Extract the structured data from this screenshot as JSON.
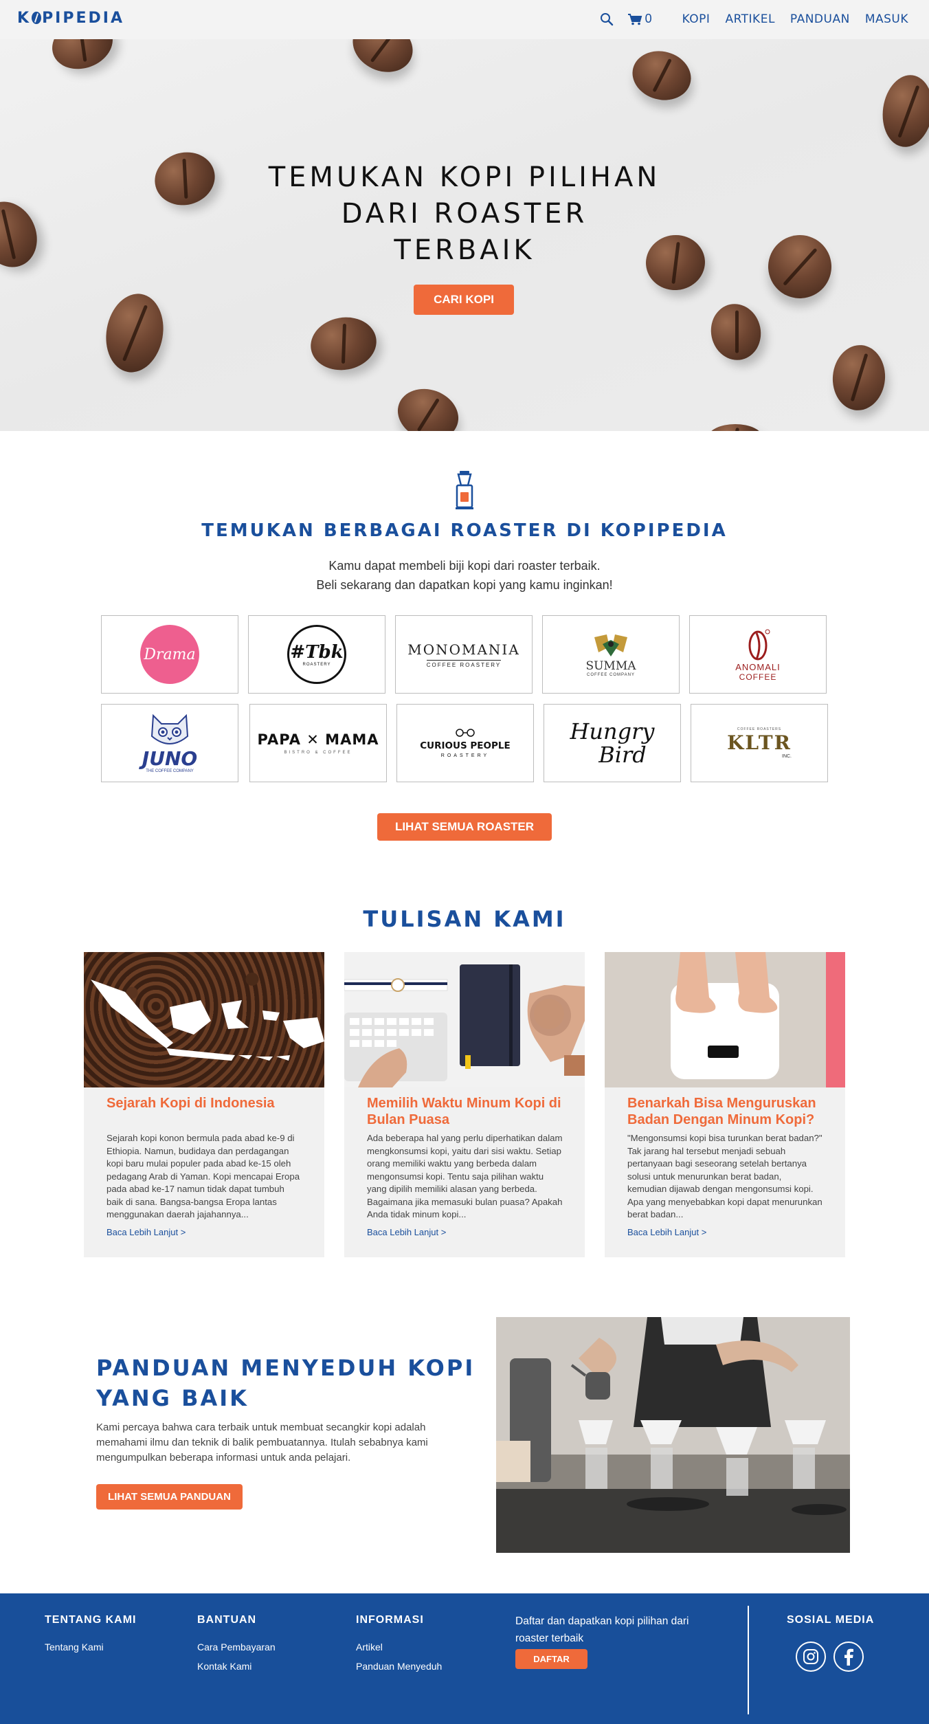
{
  "nav": {
    "logo": "KOPIPEDIA",
    "cart_count": "0",
    "links": [
      "KOPI",
      "ARTIKEL",
      "PANDUAN",
      "MASUK"
    ]
  },
  "hero": {
    "title_lines": [
      "TEMUKAN KOPI PILIHAN",
      "DARI ROASTER",
      "TERBAIK"
    ],
    "button": "CARI KOPI"
  },
  "roasters": {
    "title": "TEMUKAN BERBAGAI ROASTER DI KOPIPEDIA",
    "subtitle_lines": [
      "Kamu dapat membeli biji kopi dari roaster terbaik.",
      "Beli sekarang dan dapatkan kopi yang kamu inginkan!"
    ],
    "logos": {
      "drama": "Drama",
      "tbk": "#Tbk",
      "tbk_sub": "ROASTERY",
      "monomania": "MONOMANIA",
      "monomania_sub": "COFFEE ROASTERY",
      "summa": "SUMMA",
      "summa_sub": "COFFEE COMPANY",
      "anomali": "ANOMALI",
      "anomali_sub": "COFFEE",
      "juno": "JUNO",
      "juno_sub": "THE COFFEE COMPANY",
      "papamama": "PAPA ✕ MAMA",
      "papamama_sub": "BISTRO & COFFEE",
      "curious": "CURIOUS PEOPLE",
      "curious_sub": "ROASTERY",
      "hungry": "Hungry",
      "bird": "Bird",
      "kltr": "KLTR",
      "kltr_top": "COFFEE   ROASTERS",
      "kltr_sub": "INC."
    },
    "button": "LIHAT SEMUA ROASTER"
  },
  "articles": {
    "title": "TULISAN KAMI",
    "items": [
      {
        "title": "Sejarah Kopi di Indonesia",
        "body": "Sejarah kopi konon bermula pada abad ke-9 di Ethiopia. Namun, budidaya dan perdagangan kopi baru mulai populer pada abad ke-15 oleh pedagang Arab di Yaman. Kopi mencapai Eropa pada abad ke-17 namun tidak dapat tumbuh baik di sana. Bangsa-bangsa Eropa lantas menggunakan daerah jajahannya...",
        "link": "Baca Lebih Lanjut >"
      },
      {
        "title": "Memilih Waktu Minum Kopi di Bulan Puasa",
        "body": "Ada beberapa hal yang perlu diperhatikan dalam mengkonsumsi kopi, yaitu dari sisi waktu. Setiap orang memiliki waktu yang berbeda dalam mengonsumsi kopi. Tentu saja pilihan waktu yang dipilih memiliki alasan yang berbeda. Bagaimana jika memasuki bulan puasa?  Apakah Anda tidak minum kopi...",
        "link": "Baca Lebih Lanjut >"
      },
      {
        "title": "Benarkah Bisa Menguruskan Badan Dengan Minum Kopi?",
        "body": "\"Mengonsumsi kopi bisa turunkan berat badan?\" Tak jarang hal tersebut menjadi sebuah pertanyaan bagi seseorang setelah bertanya solusi untuk menurunkan berat badan, kemudian dijawab dengan mengonsumsi kopi. Apa yang menyebabkan kopi dapat menurunkan berat badan...",
        "link": "Baca Lebih Lanjut >"
      }
    ]
  },
  "guide": {
    "title_lines": [
      "PANDUAN MENYEDUH KOPI",
      "YANG BAIK"
    ],
    "text": "Kami percaya bahwa cara terbaik untuk membuat secangkir kopi adalah memahami ilmu dan teknik di balik pembuatannya. Itulah sebabnya kami mengumpulkan beberapa informasi untuk anda pelajari.",
    "button": "LIHAT SEMUA PANDUAN"
  },
  "footer": {
    "tentang": {
      "heading": "TENTANG KAMI",
      "links": [
        "Tentang Kami"
      ]
    },
    "bantuan": {
      "heading": "BANTUAN",
      "links": [
        "Cara Pembayaran",
        "Kontak Kami"
      ]
    },
    "informasi": {
      "heading": "INFORMASI",
      "links": [
        "Artikel",
        "Panduan Menyeduh"
      ]
    },
    "signup_text_lines": [
      "Daftar dan dapatkan kopi pilihan dari",
      "roaster terbaik"
    ],
    "signup_button": "DAFTAR",
    "social_heading": "SOSIAL MEDIA"
  },
  "colors": {
    "brand_blue": "#1a4f9c",
    "accent_orange": "#ef6a3a",
    "footer_blue": "#184f9a",
    "card_bg": "#f1f1f1"
  }
}
